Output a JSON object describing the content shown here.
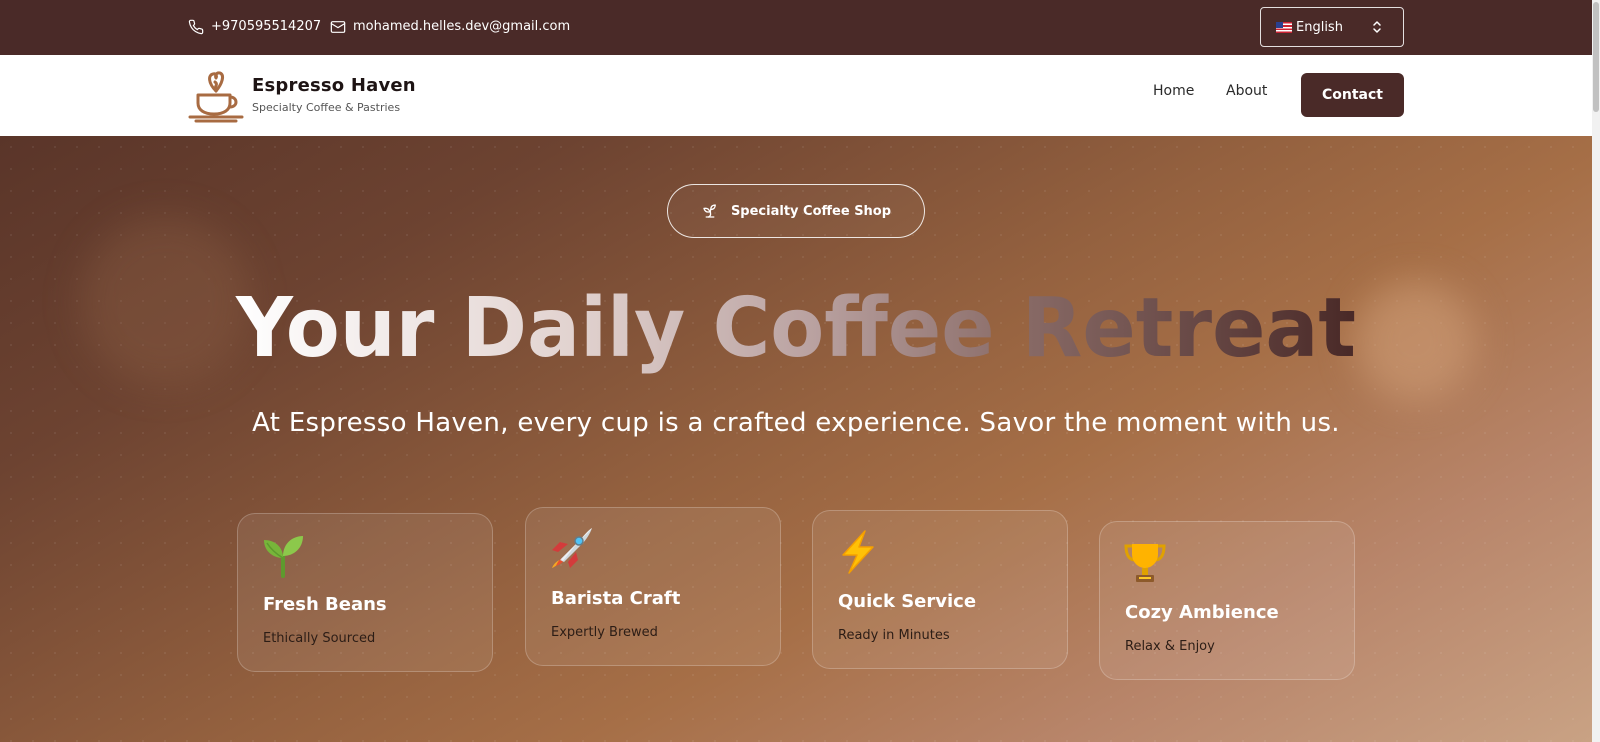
{
  "topbar": {
    "phone": "+970595514207",
    "email": "mohamed.helles.dev@gmail.com",
    "language": "English"
  },
  "nav": {
    "brand_name": "Espresso Haven",
    "brand_tagline": "Specialty Coffee & Pastries",
    "links": {
      "home": "Home",
      "about": "About",
      "contact": "Contact"
    }
  },
  "hero": {
    "badge": "Specialty Coffee Shop",
    "headline": [
      "Your",
      "Daily",
      "Coffee",
      "Retreat"
    ],
    "subtitle": "At Espresso Haven, every cup is a crafted experience. Savor the moment with us.",
    "features": [
      {
        "icon": "seedling-icon",
        "title": "Fresh Beans",
        "subtitle": "Ethically Sourced"
      },
      {
        "icon": "rocket-icon",
        "title": "Barista Craft",
        "subtitle": "Expertly Brewed"
      },
      {
        "icon": "lightning-icon",
        "title": "Quick Service",
        "subtitle": "Ready in Minutes"
      },
      {
        "icon": "trophy-icon",
        "title": "Cozy Ambience",
        "subtitle": "Relax & Enjoy"
      }
    ]
  },
  "colors": {
    "topbar_bg": "#4a2a28",
    "accent": "#4a2a28",
    "logo_brown": "#a86b42",
    "hero_start": "#5a3529",
    "hero_end": "#c9a284"
  }
}
